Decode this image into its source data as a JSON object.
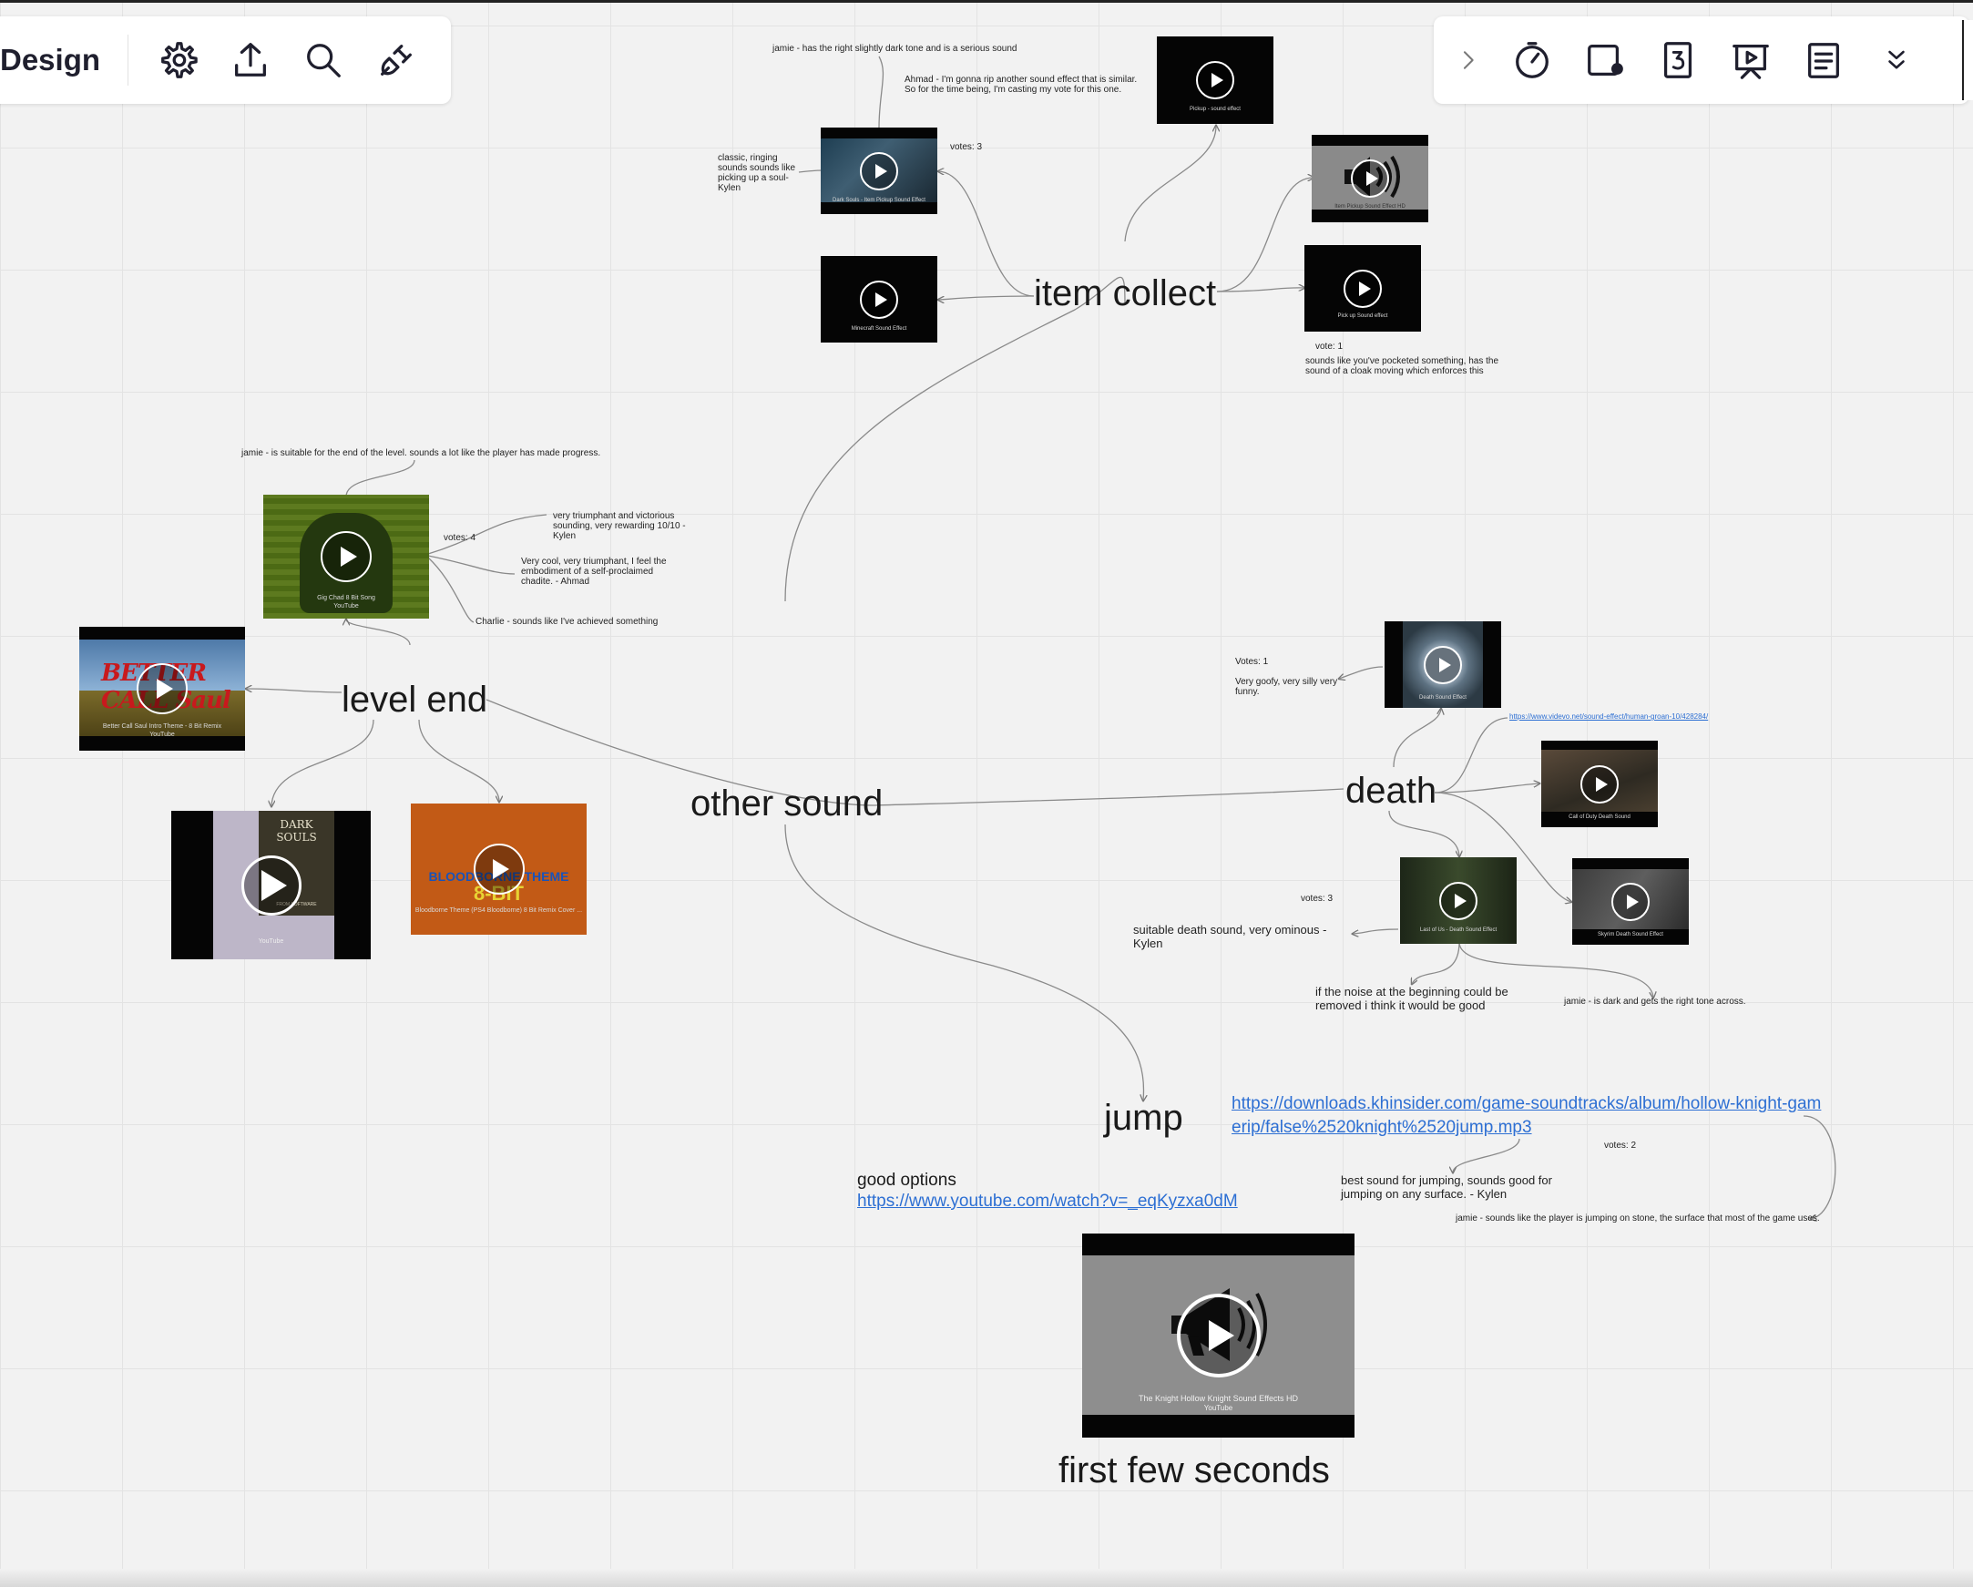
{
  "toolbar_left": {
    "board_title": "Design"
  },
  "icons": [
    "gear-icon",
    "upload-icon",
    "search-icon",
    "plug-icon",
    "chevron-right-icon",
    "timer-icon",
    "card-dot-icon",
    "counter-3-icon",
    "presentation-icon",
    "notes-icon",
    "double-chevron-down-icon"
  ],
  "topics": {
    "item_collect": "item collect",
    "other_sound": "other sound",
    "level_end": "level end",
    "death": "death",
    "jump": "jump",
    "first_few_seconds": "first few seconds"
  },
  "notes": {
    "jamie_item": "jamie - has the right slightly dark tone and is a serious sound",
    "ahmad_item": "Ahmad - I'm gonna rip another sound effect that is similar. So for the time being, I'm casting my vote for this one.",
    "votes_item_a": "votes: 3",
    "kylen_item": "classic, ringing sounds sounds like picking up a soul-Kylen",
    "votes_item_b": "vote: 1",
    "pocketed": "sounds like you've pocketed something, has the sound of a cloak moving which enforces this",
    "jamie_level": "jamie - is suitable for the end of the level. sounds a lot like the player has made progress.",
    "votes_level": "votes: 4",
    "kylen_level": "very triumphant and victorious sounding, very rewarding 10/10 -Kylen",
    "ahmad_level": "Very cool, very triumphant, I feel the embodiment of a self-proclaimed chadite. - Ahmad",
    "charlie_level": "Charlie - sounds like I've achieved something",
    "votes_death_a": "Votes: 1",
    "goofy_death": "Very goofy, very silly very funny.",
    "votes_death_b": "votes: 3",
    "ominous_death": "suitable death sound, very ominous - Kylen",
    "noise_death": "if the noise at the beginning could be removed i think it would be good",
    "jamie_death": "jamie - is dark and gets the right tone across.",
    "good_options": "good options",
    "votes_jump": "votes: 2",
    "kylen_jump": "best sound for jumping, sounds good for jumping on any surface. - Kylen",
    "jamie_jump": "jamie - sounds like the player is jumping on stone, the surface that most of the game uses."
  },
  "links": {
    "videvo": "https://www.videvo.net/sound-effect/human-groan-10/428284/",
    "khinsider": "https://downloads.khinsider.com/game-soundtracks/album/hollow-knight-gamerip/false%2520knight%2520jump.mp3",
    "youtube": "https://www.youtube.com/watch?v=_eqKyzxa0dM"
  },
  "videos": {
    "v_item_a": "Dark Souls - Item Pickup Sound Effect",
    "v_item_pickup": "Pickup - sound effect",
    "v_item_c": "Item Pickup Sound Effect HD",
    "v_item_d": "Minecraft Sound Effect",
    "v_item_e": "Pick up Sound effect",
    "v_level_a": "Gig Chad 8 Bit Song",
    "v_level_bcs": "Better Call Saul Intro Theme - 8 Bit Remix",
    "v_level_ds": "DARK SOULS",
    "v_level_ds_sub": "FROM SOFTWARE",
    "v_level_bb": "Bloodborne Theme (PS4 Bloodborne) 8 Bit Remix Cover ...",
    "v_level_bb_title": "BLOODBORNE THEME",
    "v_level_bb_sub": "8-BIT",
    "v_level_bcs_logo": "BETTER CALL Saul",
    "v_death_a": "Death Sound Effect",
    "v_death_b": "Call of Duty Death Sound",
    "v_death_c": "Last of Us - Death Sound Effect",
    "v_death_d": "Skyrim Death Sound Effect",
    "v_jump": "The Knight Hollow Knight Sound Effects HD",
    "youtube_tag": "YouTube"
  }
}
